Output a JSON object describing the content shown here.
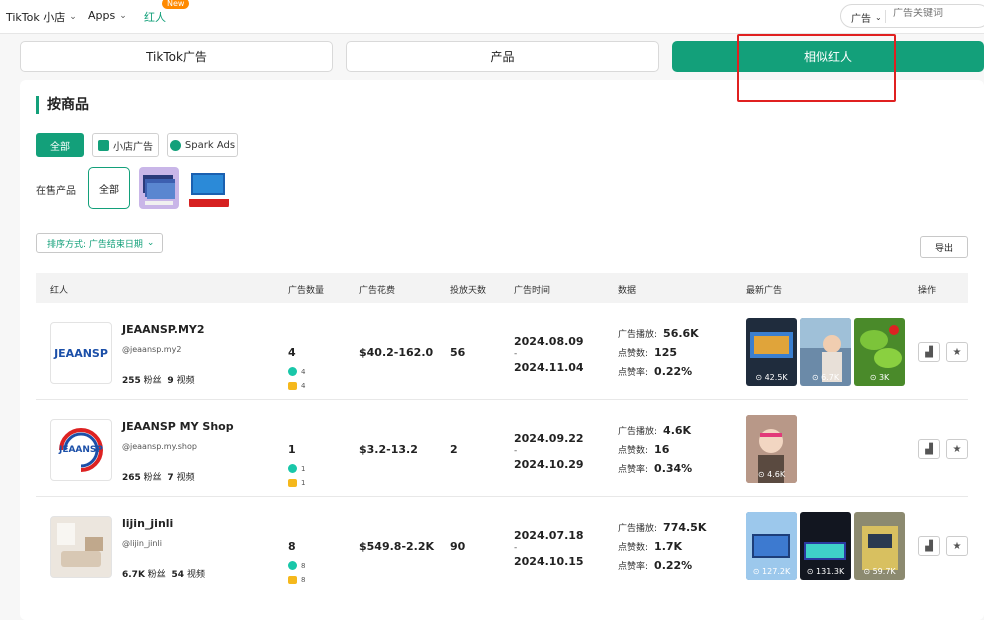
{
  "topnav": {
    "items": [
      {
        "label": "TikTok 小店",
        "chevron": true
      },
      {
        "label": "Apps",
        "chevron": true
      },
      {
        "label": "红人",
        "chevron": false
      }
    ],
    "new_badge": "New",
    "search": {
      "select_label": "广告",
      "placeholder": "广告关键词"
    }
  },
  "tabs": [
    {
      "label": "TikTok广告",
      "active": false
    },
    {
      "label": "产品",
      "active": false
    },
    {
      "label": "相似红人",
      "active": true
    }
  ],
  "section": {
    "title": "按商品",
    "filters": [
      {
        "label": "全部",
        "active": true
      },
      {
        "label": "小店广告",
        "active": false,
        "icon": "shop-bag-icon"
      },
      {
        "label": "Spark Ads",
        "active": false,
        "icon": "spark-icon"
      }
    ],
    "on_sale_label": "在售产品",
    "product_all": "全部",
    "sort_label": "排序方式: 广告结束日期",
    "export_label": "导出"
  },
  "table": {
    "headers": [
      "红人",
      "广告数量",
      "广告花费",
      "投放天数",
      "广告时间",
      "数据",
      "最新广告",
      "操作"
    ],
    "rows": [
      {
        "name": "JEAANSP.MY2",
        "handle": "@jeaansp.my2",
        "fans": "255",
        "fans_label": "粉丝",
        "videos": "9",
        "videos_label": "视频",
        "avatar_text": "JEAANSP",
        "ad_count": "4",
        "spark": "4",
        "shop": "4",
        "spend": "$40.2-162.0",
        "days": "56",
        "start": "2024.08.09",
        "dash": "-",
        "end": "2024.11.04",
        "plays_label": "广告播放:",
        "plays": "56.6K",
        "likes_label": "点赞数:",
        "likes": "125",
        "rate_label": "点赞率:",
        "rate": "0.22%",
        "videos_list": [
          {
            "views": "42.5K",
            "color": "#1f2c3d"
          },
          {
            "views": "6.7K",
            "color": "#6b8aa8"
          },
          {
            "views": "3K",
            "color": "#4a8a2a"
          }
        ]
      },
      {
        "name": "JEAANSP MY Shop",
        "handle": "@jeaansp.my.shop",
        "fans": "265",
        "fans_label": "粉丝",
        "videos": "7",
        "videos_label": "视频",
        "avatar_text": "JEAANSP",
        "ad_count": "1",
        "spark": "1",
        "shop": "1",
        "spend": "$3.2-13.2",
        "days": "2",
        "start": "2024.09.22",
        "dash": "-",
        "end": "2024.10.29",
        "plays_label": "广告播放:",
        "plays": "4.6K",
        "likes_label": "点赞数:",
        "likes": "16",
        "rate_label": "点赞率:",
        "rate": "0.34%",
        "videos_list": [
          {
            "views": "4.6K",
            "color": "#a37a6a"
          }
        ]
      },
      {
        "name": "lijin_jinli",
        "handle": "@lijin_jinli",
        "fans": "6.7K",
        "fans_label": "粉丝",
        "videos": "54",
        "videos_label": "视频",
        "avatar_text": "",
        "ad_count": "8",
        "spark": "8",
        "shop": "8",
        "spend": "$549.8-2.2K",
        "days": "90",
        "start": "2024.07.18",
        "dash": "-",
        "end": "2024.10.15",
        "plays_label": "广告播放:",
        "plays": "774.5K",
        "likes_label": "点赞数:",
        "likes": "1.7K",
        "rate_label": "点赞率:",
        "rate": "0.22%",
        "videos_list": [
          {
            "views": "127.2K",
            "color": "#4d7fb0"
          },
          {
            "views": "131.3K",
            "color": "#121620"
          },
          {
            "views": "59.7K",
            "color": "#8c8a70"
          }
        ]
      }
    ]
  },
  "colors": {
    "accent": "#13a07a",
    "annotation": "#e02020",
    "badge": "#ff8a00"
  }
}
